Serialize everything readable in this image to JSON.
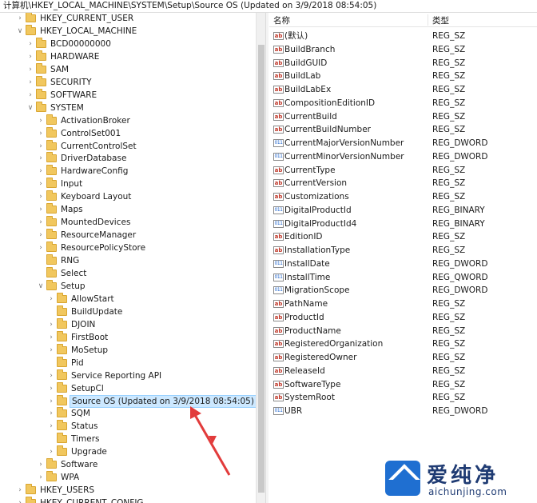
{
  "address_bar": "计算机\\HKEY_LOCAL_MACHINE\\SYSTEM\\Setup\\Source OS (Updated on 3/9/2018 08:54:05)",
  "tree": [
    {
      "label": "HKEY_CURRENT_USER",
      "level": 1,
      "expanded": false
    },
    {
      "label": "HKEY_LOCAL_MACHINE",
      "level": 1,
      "expanded": true
    },
    {
      "label": "BCD00000000",
      "level": 2,
      "expanded": false
    },
    {
      "label": "HARDWARE",
      "level": 2,
      "expanded": false
    },
    {
      "label": "SAM",
      "level": 2,
      "expanded": false
    },
    {
      "label": "SECURITY",
      "level": 2,
      "expanded": false
    },
    {
      "label": "SOFTWARE",
      "level": 2,
      "expanded": false
    },
    {
      "label": "SYSTEM",
      "level": 2,
      "expanded": true
    },
    {
      "label": "ActivationBroker",
      "level": 3,
      "expanded": false
    },
    {
      "label": "ControlSet001",
      "level": 3,
      "expanded": false
    },
    {
      "label": "CurrentControlSet",
      "level": 3,
      "expanded": false
    },
    {
      "label": "DriverDatabase",
      "level": 3,
      "expanded": false
    },
    {
      "label": "HardwareConfig",
      "level": 3,
      "expanded": false
    },
    {
      "label": "Input",
      "level": 3,
      "expanded": false
    },
    {
      "label": "Keyboard Layout",
      "level": 3,
      "expanded": false
    },
    {
      "label": "Maps",
      "level": 3,
      "expanded": false
    },
    {
      "label": "MountedDevices",
      "level": 3,
      "expanded": false
    },
    {
      "label": "ResourceManager",
      "level": 3,
      "expanded": false
    },
    {
      "label": "ResourcePolicyStore",
      "level": 3,
      "expanded": false
    },
    {
      "label": "RNG",
      "level": 3,
      "leaf": true
    },
    {
      "label": "Select",
      "level": 3,
      "leaf": true
    },
    {
      "label": "Setup",
      "level": 3,
      "expanded": true
    },
    {
      "label": "AllowStart",
      "level": 4,
      "expanded": false
    },
    {
      "label": "BuildUpdate",
      "level": 4,
      "leaf": true
    },
    {
      "label": "DJOIN",
      "level": 4,
      "expanded": false
    },
    {
      "label": "FirstBoot",
      "level": 4,
      "expanded": false
    },
    {
      "label": "MoSetup",
      "level": 4,
      "expanded": false
    },
    {
      "label": "Pid",
      "level": 4,
      "leaf": true
    },
    {
      "label": "Service Reporting API",
      "level": 4,
      "expanded": false
    },
    {
      "label": "SetupCl",
      "level": 4,
      "expanded": false
    },
    {
      "label": "Source OS (Updated on 3/9/2018 08:54:05)",
      "level": 4,
      "expanded": false,
      "selected": true
    },
    {
      "label": "SQM",
      "level": 4,
      "expanded": false
    },
    {
      "label": "Status",
      "level": 4,
      "expanded": false
    },
    {
      "label": "Timers",
      "level": 4,
      "leaf": true
    },
    {
      "label": "Upgrade",
      "level": 4,
      "expanded": false
    },
    {
      "label": "Software",
      "level": 3,
      "expanded": false
    },
    {
      "label": "WPA",
      "level": 3,
      "expanded": false
    },
    {
      "label": "HKEY_USERS",
      "level": 1,
      "expanded": false
    },
    {
      "label": "HKEY_CURRENT_CONFIG",
      "level": 1,
      "expanded": false
    }
  ],
  "list": {
    "col_name": "名称",
    "col_type": "类型",
    "rows": [
      {
        "name": "(默认)",
        "type": "REG_SZ",
        "icon": "string-value-icon"
      },
      {
        "name": "BuildBranch",
        "type": "REG_SZ",
        "icon": "string-value-icon"
      },
      {
        "name": "BuildGUID",
        "type": "REG_SZ",
        "icon": "string-value-icon"
      },
      {
        "name": "BuildLab",
        "type": "REG_SZ",
        "icon": "string-value-icon"
      },
      {
        "name": "BuildLabEx",
        "type": "REG_SZ",
        "icon": "string-value-icon"
      },
      {
        "name": "CompositionEditionID",
        "type": "REG_SZ",
        "icon": "string-value-icon"
      },
      {
        "name": "CurrentBuild",
        "type": "REG_SZ",
        "icon": "string-value-icon"
      },
      {
        "name": "CurrentBuildNumber",
        "type": "REG_SZ",
        "icon": "string-value-icon"
      },
      {
        "name": "CurrentMajorVersionNumber",
        "type": "REG_DWORD",
        "icon": "binary-value-icon"
      },
      {
        "name": "CurrentMinorVersionNumber",
        "type": "REG_DWORD",
        "icon": "binary-value-icon"
      },
      {
        "name": "CurrentType",
        "type": "REG_SZ",
        "icon": "string-value-icon"
      },
      {
        "name": "CurrentVersion",
        "type": "REG_SZ",
        "icon": "string-value-icon"
      },
      {
        "name": "Customizations",
        "type": "REG_SZ",
        "icon": "string-value-icon"
      },
      {
        "name": "DigitalProductId",
        "type": "REG_BINARY",
        "icon": "binary-value-icon"
      },
      {
        "name": "DigitalProductId4",
        "type": "REG_BINARY",
        "icon": "binary-value-icon"
      },
      {
        "name": "EditionID",
        "type": "REG_SZ",
        "icon": "string-value-icon"
      },
      {
        "name": "InstallationType",
        "type": "REG_SZ",
        "icon": "string-value-icon"
      },
      {
        "name": "InstallDate",
        "type": "REG_DWORD",
        "icon": "binary-value-icon"
      },
      {
        "name": "InstallTime",
        "type": "REG_QWORD",
        "icon": "binary-value-icon"
      },
      {
        "name": "MigrationScope",
        "type": "REG_DWORD",
        "icon": "binary-value-icon"
      },
      {
        "name": "PathName",
        "type": "REG_SZ",
        "icon": "string-value-icon"
      },
      {
        "name": "ProductId",
        "type": "REG_SZ",
        "icon": "string-value-icon"
      },
      {
        "name": "ProductName",
        "type": "REG_SZ",
        "icon": "string-value-icon"
      },
      {
        "name": "RegisteredOrganization",
        "type": "REG_SZ",
        "icon": "string-value-icon"
      },
      {
        "name": "RegisteredOwner",
        "type": "REG_SZ",
        "icon": "string-value-icon"
      },
      {
        "name": "ReleaseId",
        "type": "REG_SZ",
        "icon": "string-value-icon"
      },
      {
        "name": "SoftwareType",
        "type": "REG_SZ",
        "icon": "string-value-icon"
      },
      {
        "name": "SystemRoot",
        "type": "REG_SZ",
        "icon": "string-value-icon"
      },
      {
        "name": "UBR",
        "type": "REG_DWORD",
        "icon": "binary-value-icon"
      }
    ]
  },
  "watermark": {
    "zh": "爱纯净",
    "en": "aichunjing.com"
  },
  "colors": {
    "selection": "#cce8ff",
    "arrow": "#e23b3b",
    "folder": "#f1c75e"
  }
}
